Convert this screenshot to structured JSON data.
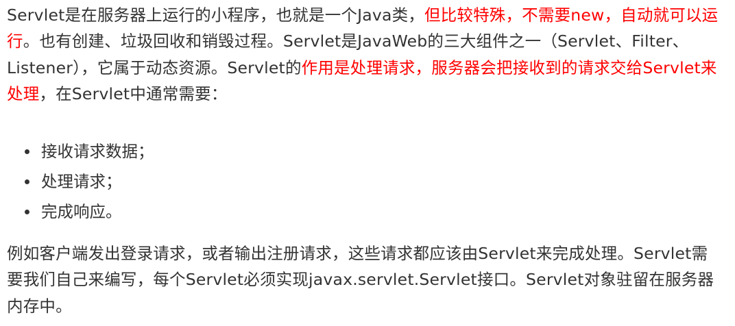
{
  "paragraph1": {
    "seg1": "Servlet是在服务器上运行的小程序，也就是一个Java类，",
    "seg2_highlight": "但比较特殊，不需要new，自动就可以运行",
    "seg3": "。也有创建、垃圾回收和销毁过程。Servlet是JavaWeb的三大组件之一（Servlet、Filter、Listener），它属于动态资源。Servlet的",
    "seg4_highlight": "作用是处理请求，服务器会把接收到的请求交给Servlet来处理",
    "seg5": "，在Servlet中通常需要："
  },
  "list": {
    "items": [
      "接收请求数据；",
      "处理请求；",
      "完成响应。"
    ]
  },
  "paragraph2": {
    "text": "例如客户端发出登录请求，或者输出注册请求，这些请求都应该由Servlet来完成处理。Servlet需要我们自己来编写，每个Servlet必须实现javax.servlet.Servlet接口。Servlet对象驻留在服务器内存中。"
  },
  "colors": {
    "text": "#333333",
    "highlight": "#ff0000",
    "background": "#ffffff"
  }
}
